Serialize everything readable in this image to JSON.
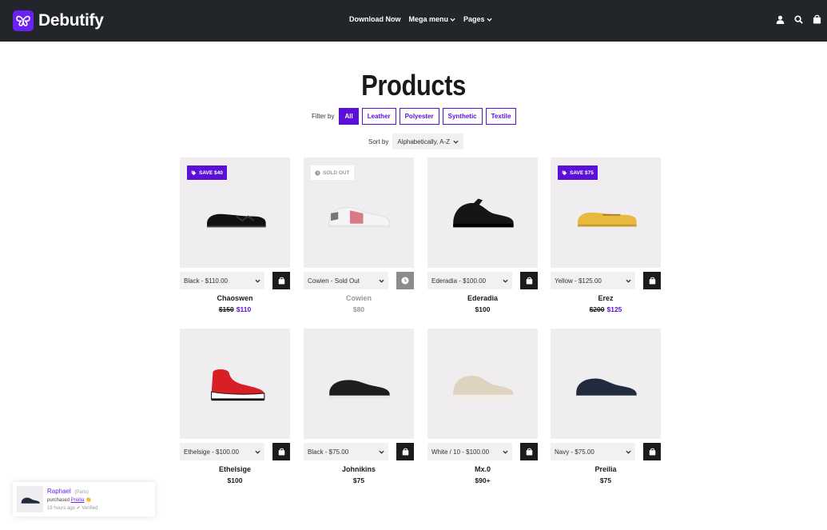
{
  "header": {
    "brand": "Debutify",
    "nav": [
      {
        "label": "Download Now",
        "dropdown": false
      },
      {
        "label": "Mega menu",
        "dropdown": true
      },
      {
        "label": "Pages",
        "dropdown": true
      }
    ],
    "icons": [
      "user-icon",
      "search-icon",
      "bag-icon"
    ]
  },
  "page": {
    "title": "Products",
    "filter_label": "Filter by",
    "filters": [
      "All",
      "Leather",
      "Polyester",
      "Synthetic",
      "Textile"
    ],
    "active_filter": "All",
    "sort_label": "Sort by",
    "sort_value": "Alphabetically, A-Z"
  },
  "products": [
    {
      "name": "Chaoswen",
      "variant": "Black - $110.00",
      "price_old": "$150",
      "price": "$110",
      "badge": "SAVE $40",
      "badge_type": "save",
      "sold_out": false,
      "shoe": "loafer-black"
    },
    {
      "name": "Cowien",
      "variant": "Cowien - Sold Out",
      "price_old": "",
      "price": "$80",
      "badge": "SOLD OUT",
      "badge_type": "soldout",
      "sold_out": true,
      "shoe": "sneaker-white"
    },
    {
      "name": "Ederadia",
      "variant": "Ederadia - $100.00",
      "price_old": "",
      "price": "$100",
      "badge": "",
      "badge_type": "",
      "sold_out": false,
      "shoe": "runner-black"
    },
    {
      "name": "Erez",
      "variant": "Yellow - $125.00",
      "price_old": "$200",
      "price": "$125",
      "badge": "SAVE $75",
      "badge_type": "save",
      "sold_out": false,
      "shoe": "loafer-yellow"
    },
    {
      "name": "Ethelsige",
      "variant": "Ethelsige - $100.00",
      "price_old": "",
      "price": "$100",
      "badge": "",
      "badge_type": "",
      "sold_out": false,
      "shoe": "sock-red"
    },
    {
      "name": "Johnikins",
      "variant": "Black - $75.00",
      "price_old": "",
      "price": "$75",
      "badge": "",
      "badge_type": "",
      "sold_out": false,
      "shoe": "sneaker-black"
    },
    {
      "name": "Mx.0",
      "variant": "White / 10 - $100.00",
      "price_old": "",
      "price": "$90+",
      "badge": "",
      "badge_type": "",
      "sold_out": false,
      "shoe": "runner-beige"
    },
    {
      "name": "Preilia",
      "variant": "Navy - $75.00",
      "price_old": "",
      "price": "$75",
      "badge": "",
      "badge_type": "",
      "sold_out": false,
      "shoe": "sneaker-navy"
    }
  ],
  "toast": {
    "name": "Raphael",
    "city": "(Paris)",
    "purchased_prefix": "purchased",
    "product": "Preilia",
    "time": "19 hours ago",
    "verified": "Verified"
  },
  "colors": {
    "accent": "#5a10d6",
    "header_bg": "#22252a",
    "card_bg": "#efedf0"
  }
}
